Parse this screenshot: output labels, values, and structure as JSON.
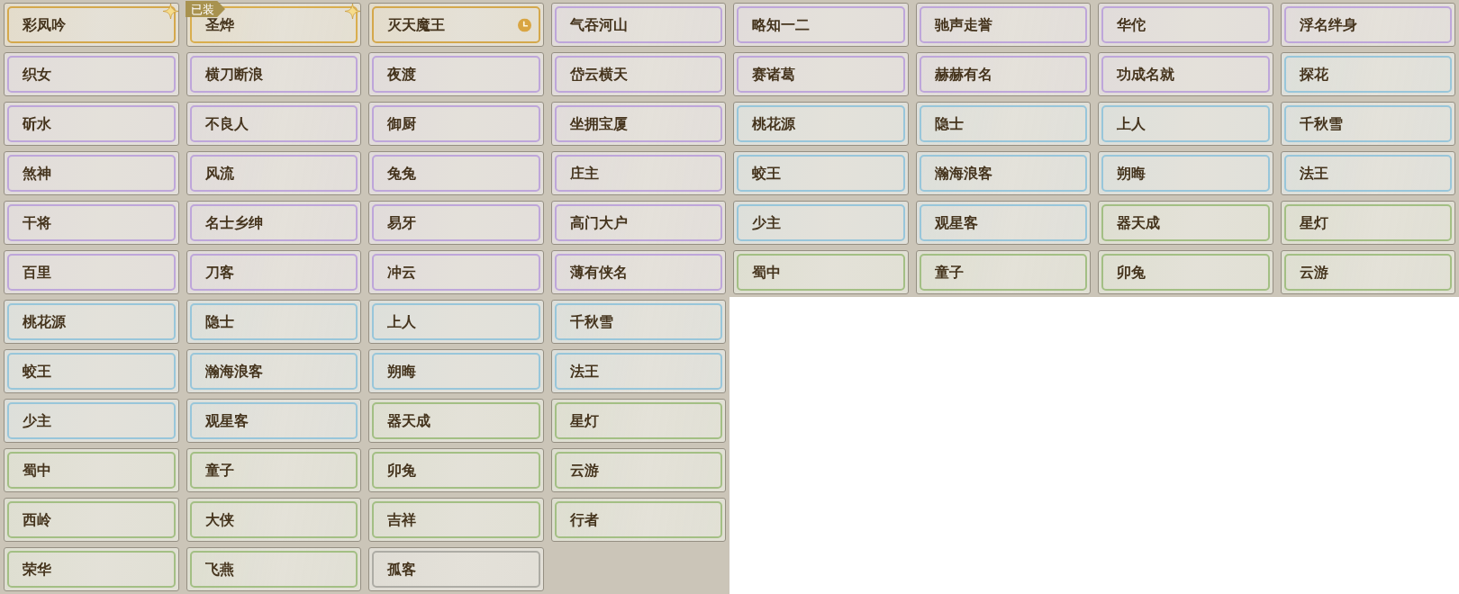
{
  "panels": [
    {
      "titles": [
        {
          "name": "彩凤吟",
          "color": "#d4a84c",
          "sparkle": true,
          "timed": false
        },
        {
          "name": "圣烨",
          "color": "#d9ae4e",
          "sparkle": true,
          "timed": false,
          "badge": "已装"
        },
        {
          "name": "灭天魔王",
          "color": "#d4a84c",
          "sparkle": false,
          "timed": true
        },
        {
          "name": "气吞河山",
          "color": "#bea6da",
          "sparkle": false,
          "timed": false
        },
        {
          "name": "略知一二",
          "color": "#bea6da",
          "sparkle": false,
          "timed": false
        },
        {
          "name": "驰声走誉",
          "color": "#bea6da",
          "sparkle": false,
          "timed": false
        },
        {
          "name": "华佗",
          "color": "#bea6da",
          "sparkle": false,
          "timed": false
        },
        {
          "name": "浮名绊身",
          "color": "#bea6da",
          "sparkle": false,
          "timed": false
        },
        {
          "name": "织女",
          "color": "#bea6da",
          "sparkle": false,
          "timed": false
        },
        {
          "name": "横刀断浪",
          "color": "#bea6da",
          "sparkle": false,
          "timed": false
        },
        {
          "name": "夜渡",
          "color": "#bea6da",
          "sparkle": false,
          "timed": false
        },
        {
          "name": "岱云横天",
          "color": "#bea6da",
          "sparkle": false,
          "timed": false
        },
        {
          "name": "赛诸葛",
          "color": "#bea6da",
          "sparkle": false,
          "timed": false
        },
        {
          "name": "赫赫有名",
          "color": "#bea6da",
          "sparkle": false,
          "timed": false
        },
        {
          "name": "功成名就",
          "color": "#bea6da",
          "sparkle": false,
          "timed": false
        },
        {
          "name": "探花",
          "color": "#98c6da",
          "sparkle": false,
          "timed": false
        },
        {
          "name": "斫水",
          "color": "#bea6da",
          "sparkle": false,
          "timed": false
        },
        {
          "name": "不良人",
          "color": "#bea6da",
          "sparkle": false,
          "timed": false
        },
        {
          "name": "御厨",
          "color": "#bea6da",
          "sparkle": false,
          "timed": false
        },
        {
          "name": "坐拥宝厦",
          "color": "#bea6da",
          "sparkle": false,
          "timed": false
        },
        {
          "name": "桃花源",
          "color": "#98c6da",
          "sparkle": false,
          "timed": false
        },
        {
          "name": "隐士",
          "color": "#98c6da",
          "sparkle": false,
          "timed": false
        },
        {
          "name": "上人",
          "color": "#98c6da",
          "sparkle": false,
          "timed": false
        },
        {
          "name": "千秋雪",
          "color": "#98c6da",
          "sparkle": false,
          "timed": false
        },
        {
          "name": "煞神",
          "color": "#bea6da",
          "sparkle": false,
          "timed": false
        },
        {
          "name": "风流",
          "color": "#bea6da",
          "sparkle": false,
          "timed": false
        },
        {
          "name": "兔兔",
          "color": "#bea6da",
          "sparkle": false,
          "timed": false
        },
        {
          "name": "庄主",
          "color": "#bea6da",
          "sparkle": false,
          "timed": false
        },
        {
          "name": "蛟王",
          "color": "#98c6da",
          "sparkle": false,
          "timed": false
        },
        {
          "name": "瀚海浪客",
          "color": "#98c6da",
          "sparkle": false,
          "timed": false
        },
        {
          "name": "朔晦",
          "color": "#98c6da",
          "sparkle": false,
          "timed": false
        },
        {
          "name": "法王",
          "color": "#98c6da",
          "sparkle": false,
          "timed": false
        },
        {
          "name": "干将",
          "color": "#bea6da",
          "sparkle": false,
          "timed": false
        },
        {
          "name": "名士乡绅",
          "color": "#bea6da",
          "sparkle": false,
          "timed": false
        },
        {
          "name": "易牙",
          "color": "#bea6da",
          "sparkle": false,
          "timed": false
        },
        {
          "name": "高门大户",
          "color": "#bea6da",
          "sparkle": false,
          "timed": false
        },
        {
          "name": "少主",
          "color": "#98c6da",
          "sparkle": false,
          "timed": false
        },
        {
          "name": "观星客",
          "color": "#98c6da",
          "sparkle": false,
          "timed": false
        },
        {
          "name": "器天成",
          "color": "#a3bf84",
          "sparkle": false,
          "timed": false
        },
        {
          "name": "星灯",
          "color": "#a3bf84",
          "sparkle": false,
          "timed": false
        },
        {
          "name": "百里",
          "color": "#bea6da",
          "sparkle": false,
          "timed": false
        },
        {
          "name": "刀客",
          "color": "#bea6da",
          "sparkle": false,
          "timed": false
        },
        {
          "name": "冲云",
          "color": "#bea6da",
          "sparkle": false,
          "timed": false
        },
        {
          "name": "薄有侠名",
          "color": "#bea6da",
          "sparkle": false,
          "timed": false
        },
        {
          "name": "蜀中",
          "color": "#a3bf84",
          "sparkle": false,
          "timed": false
        },
        {
          "name": "童子",
          "color": "#a3bf84",
          "sparkle": false,
          "timed": false
        },
        {
          "name": "卯兔",
          "color": "#a3bf84",
          "sparkle": false,
          "timed": false
        },
        {
          "name": "云游",
          "color": "#a3bf84",
          "sparkle": false,
          "timed": false
        }
      ]
    },
    {
      "titles": [
        {
          "name": "桃花源",
          "color": "#98c6da",
          "sparkle": false,
          "timed": false
        },
        {
          "name": "隐士",
          "color": "#98c6da",
          "sparkle": false,
          "timed": false
        },
        {
          "name": "上人",
          "color": "#98c6da",
          "sparkle": false,
          "timed": false
        },
        {
          "name": "千秋雪",
          "color": "#98c6da",
          "sparkle": false,
          "timed": false
        },
        {
          "name": "蛟王",
          "color": "#98c6da",
          "sparkle": false,
          "timed": false
        },
        {
          "name": "瀚海浪客",
          "color": "#98c6da",
          "sparkle": false,
          "timed": false
        },
        {
          "name": "朔晦",
          "color": "#98c6da",
          "sparkle": false,
          "timed": false
        },
        {
          "name": "法王",
          "color": "#98c6da",
          "sparkle": false,
          "timed": false
        },
        {
          "name": "少主",
          "color": "#98c6da",
          "sparkle": false,
          "timed": false
        },
        {
          "name": "观星客",
          "color": "#98c6da",
          "sparkle": false,
          "timed": false
        },
        {
          "name": "器天成",
          "color": "#a3bf84",
          "sparkle": false,
          "timed": false
        },
        {
          "name": "星灯",
          "color": "#a3bf84",
          "sparkle": false,
          "timed": false
        },
        {
          "name": "蜀中",
          "color": "#a3bf84",
          "sparkle": false,
          "timed": false
        },
        {
          "name": "童子",
          "color": "#a3bf84",
          "sparkle": false,
          "timed": false
        },
        {
          "name": "卯兔",
          "color": "#a3bf84",
          "sparkle": false,
          "timed": false
        },
        {
          "name": "云游",
          "color": "#a3bf84",
          "sparkle": false,
          "timed": false
        },
        {
          "name": "西岭",
          "color": "#a3bf84",
          "sparkle": false,
          "timed": false
        },
        {
          "name": "大侠",
          "color": "#a3bf84",
          "sparkle": false,
          "timed": false
        },
        {
          "name": "吉祥",
          "color": "#a3bf84",
          "sparkle": false,
          "timed": false
        },
        {
          "name": "行者",
          "color": "#a3bf84",
          "sparkle": false,
          "timed": false
        },
        {
          "name": "荣华",
          "color": "#a3bf84",
          "sparkle": false,
          "timed": false
        },
        {
          "name": "飞燕",
          "color": "#a3bf84",
          "sparkle": false,
          "timed": false
        },
        {
          "name": "孤客",
          "color": "#adaca5",
          "sparkle": false,
          "timed": false
        }
      ]
    }
  ]
}
